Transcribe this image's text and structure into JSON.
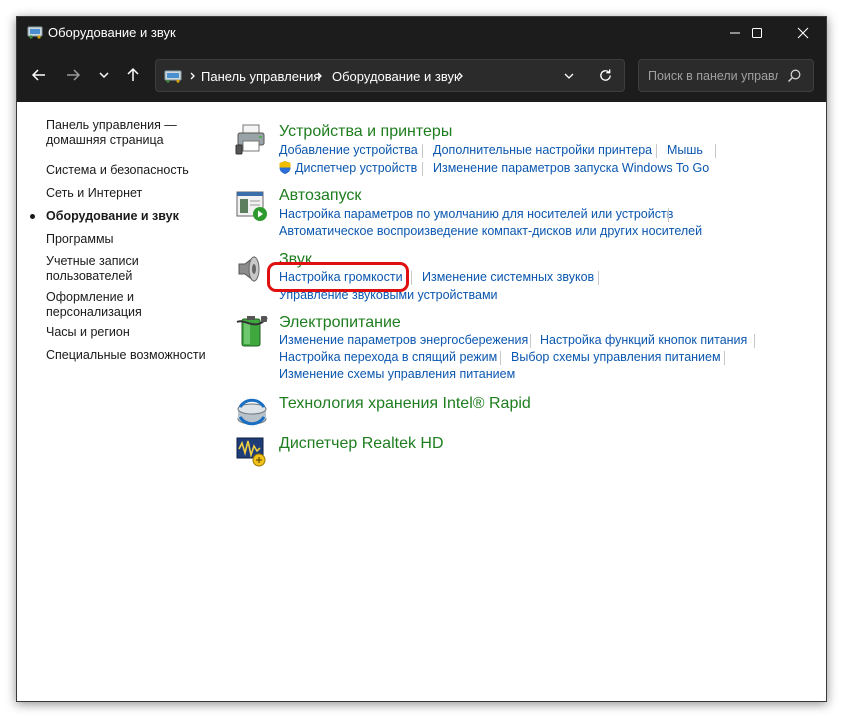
{
  "window": {
    "title": "Оборудование и звук"
  },
  "navigation": {
    "breadcrumbs": [
      "Панель управления",
      "Оборудование и звук"
    ],
    "search_placeholder": "Поиск в панели управления"
  },
  "sidebar": {
    "items": [
      {
        "label": "Панель управления — домашняя страница"
      },
      {
        "label": "Система и безопасность"
      },
      {
        "label": "Сеть и Интернет"
      },
      {
        "label": "Оборудование и звук"
      },
      {
        "label": "Программы"
      },
      {
        "label": "Учетные записи пользователей"
      },
      {
        "label": "Оформление и персонализация"
      },
      {
        "label": "Часы и регион"
      },
      {
        "label": "Специальные возможности"
      }
    ]
  },
  "categories": [
    {
      "title": "Устройства и принтеры",
      "icon": "printer-icon",
      "links": [
        "Добавление устройства",
        "Дополнительные настройки принтера",
        "Мышь",
        "Диспетчер устройств",
        "Изменение параметров запуска Windows To Go"
      ]
    },
    {
      "title": "Автозапуск",
      "icon": "autoplay-icon",
      "links": [
        "Настройка параметров по умолчанию для носителей или устройств",
        "Автоматическое воспроизведение компакт-дисков или других носителей"
      ]
    },
    {
      "title": "Звук",
      "icon": "speaker-icon",
      "links": [
        "Настройка громкости",
        "Изменение системных звуков",
        "Управление звуковыми устройствами"
      ]
    },
    {
      "title": "Электропитание",
      "icon": "battery-icon",
      "links": [
        "Изменение параметров энергосбережения",
        "Настройка функций кнопок питания",
        "Настройка перехода в спящий режим",
        "Выбор схемы управления питанием",
        "Изменение схемы управления питанием"
      ]
    },
    {
      "title": "Технология хранения Intel® Rapid",
      "icon": "intel-storage-icon",
      "links": []
    },
    {
      "title": "Диспетчер Realtek HD",
      "icon": "realtek-icon",
      "links": []
    }
  ],
  "colors": {
    "category_title": "#1e7d1e",
    "link": "#0b57b0",
    "highlight": "#e01010",
    "titlebar": "#1c1c1c"
  }
}
